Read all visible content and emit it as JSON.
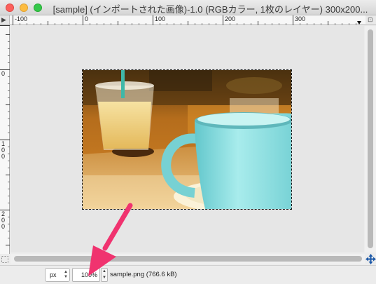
{
  "window": {
    "title": "[sample] (インポートされた画像)-1.0 (RGBカラー, 1枚のレイヤー) 300x200..."
  },
  "rulers": {
    "corner_glyph": "▶",
    "toggle_glyph": "⊡",
    "horizontal": [
      "-100",
      "0",
      "100",
      "200",
      "300"
    ],
    "vertical": [
      {
        "lines": [
          "0"
        ]
      },
      {
        "lines": [
          "1",
          "0",
          "0"
        ]
      },
      {
        "lines": [
          "2",
          "0",
          "0"
        ]
      }
    ]
  },
  "canvas": {
    "image_description": "photo-cups"
  },
  "statusbar": {
    "unit": "px",
    "zoom": "100%",
    "file_info": "sample.png (766.6 kB)"
  },
  "colors": {
    "annotation_arrow": "#f0336f"
  }
}
